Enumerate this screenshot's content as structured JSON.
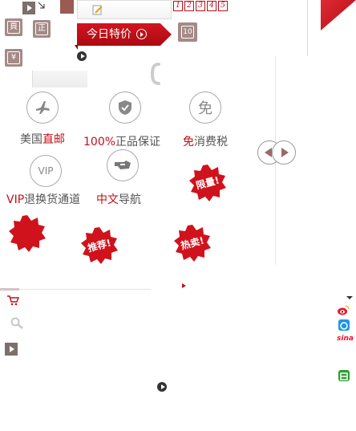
{
  "header": {
    "pager_numbers": [
      "1",
      "2",
      "3",
      "4",
      "5"
    ]
  },
  "promo": {
    "today_special": "今日特价",
    "ten_label": "10"
  },
  "side_icons": {
    "top_label": "頁",
    "right_label": "正",
    "yen_label": "¥"
  },
  "features": [
    {
      "prefix": "美国",
      "highlight": "直邮",
      "suffix": "",
      "icon": "airplane-icon"
    },
    {
      "prefix": "",
      "highlight": "100%",
      "suffix": "正品保证",
      "icon": "shield-check-icon"
    },
    {
      "prefix": "",
      "highlight": "免",
      "suffix": "消费税",
      "icon": "tax-free-icon",
      "icon_text": "免"
    },
    {
      "prefix": "",
      "highlight": "VIP",
      "suffix": "退换货通道",
      "icon": "vip-icon",
      "icon_text": "VIP"
    },
    {
      "prefix": "",
      "highlight": "中文",
      "suffix": "导航",
      "icon": "pointing-hand-icon"
    }
  ],
  "badges": {
    "limited": "限量!",
    "recommend": "推荐!",
    "hot": "热卖!"
  },
  "social": {
    "sina_label": "sina"
  },
  "colors": {
    "brand_red": "#c40e19",
    "tile_gray": "#a48a86"
  }
}
